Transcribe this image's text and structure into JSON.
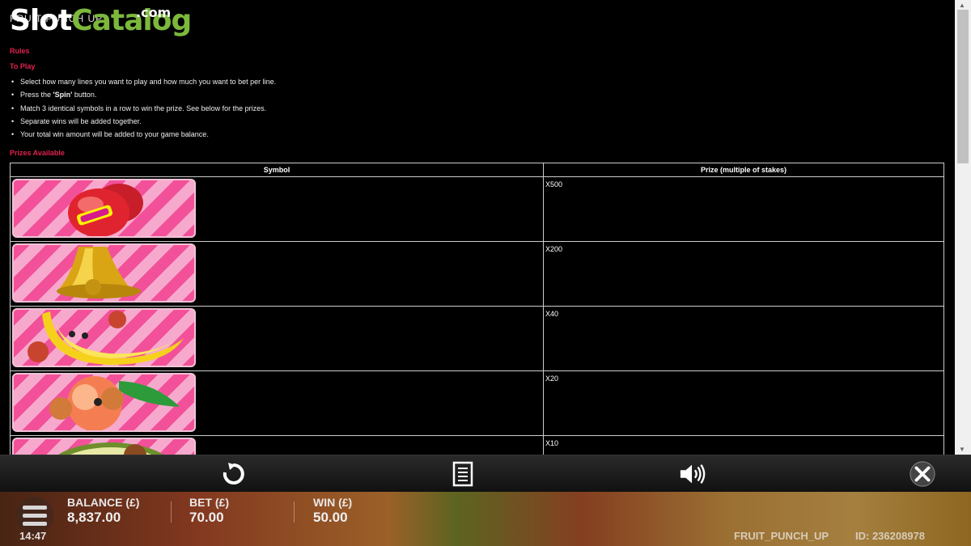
{
  "rules_page": {
    "game_title": "FRUIT PUNCH UP",
    "watermark": {
      "slot": "Slot",
      "catalog": "Catalog",
      "com": ".com"
    },
    "rules_heading": "Rules",
    "to_play_heading": "To Play",
    "rules": [
      {
        "before": "Select how many lines you want to play and how much you want to bet per line.",
        "bold": "",
        "after": ""
      },
      {
        "before": "Press the ",
        "bold": "'Spin'",
        "after": " button."
      },
      {
        "before": "Match 3 identical symbols in a row to win the prize. See below for the prizes.",
        "bold": "",
        "after": ""
      },
      {
        "before": "Separate wins will be added together.",
        "bold": "",
        "after": ""
      },
      {
        "before": "Your total win amount will be added to your game balance.",
        "bold": "",
        "after": ""
      }
    ],
    "prizes_heading": "Prizes Available",
    "table": {
      "col_symbol": "Symbol",
      "col_prize": "Prize (multiple of stakes)",
      "rows": [
        {
          "symbol": "boxing-glove-logo",
          "prize": "X500"
        },
        {
          "symbol": "bell",
          "prize": "X200"
        },
        {
          "symbol": "banana",
          "prize": "X40"
        },
        {
          "symbol": "peach",
          "prize": "X20"
        },
        {
          "symbol": "avocado",
          "prize": "X10"
        }
      ]
    }
  },
  "toolbar": {
    "icons": [
      "replay-icon",
      "paytable-icon",
      "sound-icon",
      "close-icon"
    ]
  },
  "status": {
    "balance_label": "BALANCE (£)",
    "balance_value": "8,837.00",
    "bet_label": "BET (£)",
    "bet_value": "70.00",
    "win_label": "WIN (£)",
    "win_value": "50.00",
    "clock": "14:47",
    "game_name": "FRUIT_PUNCH_UP",
    "game_id": "ID: 236208978"
  },
  "colors": {
    "heading": "#e0224f",
    "watermark_green": "#7cb83b",
    "tile_pink": "#f2519a"
  }
}
